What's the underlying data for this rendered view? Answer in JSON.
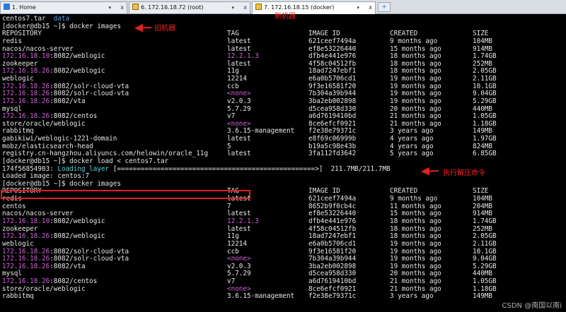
{
  "tabs": [
    {
      "label": "1. Home",
      "icon": "home-icon"
    },
    {
      "label": "6. 172.16.18.72 (root)",
      "icon": "pen-icon"
    },
    {
      "label": "7. 172.16.18.15 (docker)",
      "icon": "pen-icon",
      "active": true
    }
  ],
  "new_tab_label": "+",
  "tab_close": "x",
  "tab_dropdown": "▾",
  "annotations": {
    "old_machine": "旧机器",
    "new_machine": "新机器",
    "run_cmd": "执行解压命令"
  },
  "watermark": "CSDN @南国以南i",
  "lines": [
    {
      "segs": [
        [
          "centos7.tar",
          ""
        ],
        [
          "  ",
          ""
        ],
        [
          "data",
          "blue"
        ]
      ]
    },
    {
      "segs": [
        [
          "[docker@db15 ~]$ docker images",
          ""
        ]
      ]
    },
    {
      "cols": [
        "REPOSITORY",
        "TAG",
        "IMAGE ID",
        "CREATED",
        "SIZE"
      ]
    },
    {
      "cols": [
        "redis",
        "latest",
        "621ceef7494a",
        "9 months ago",
        "104MB"
      ]
    },
    {
      "cols": [
        "nacos/nacos-server",
        "latest",
        "ef8e53226440",
        "15 months ago",
        "914MB"
      ]
    },
    {
      "cols": [
        "172.16.18.10:8082/weblogic",
        "12.2.1.3",
        "dfb4e441e976",
        "18 months ago",
        "1.74GB"
      ],
      "ip": "172.16.18.10",
      "tagc": "pink"
    },
    {
      "cols": [
        "zookeeper",
        "latest",
        "4f58c04512fb",
        "18 months ago",
        "252MB"
      ]
    },
    {
      "cols": [
        "172.16.18.26:8082/weblogic",
        "11g",
        "18ad7247ebf1",
        "18 months ago",
        "2.05GB"
      ],
      "ip": "172.16.18.26"
    },
    {
      "cols": [
        "weblogic",
        "12214",
        "e6a0b5706cd1",
        "19 months ago",
        "2.11GB"
      ]
    },
    {
      "cols": [
        "172.16.18.26:8082/solr-cloud-vta",
        "ccb",
        "9f3e16581f20",
        "19 months ago",
        "10.1GB"
      ],
      "ip": "172.16.18.26"
    },
    {
      "cols": [
        "172.16.18.26:8082/solr-cloud-vta",
        "<none>",
        "7b304a39b944",
        "19 months ago",
        "9.04GB"
      ],
      "ip": "172.16.18.26",
      "tagc": "pink"
    },
    {
      "cols": [
        "172.16.18.26:8082/vta",
        "v2.0.3",
        "3ba2eb002898",
        "19 months ago",
        "5.29GB"
      ],
      "ip": "172.16.18.26"
    },
    {
      "cols": [
        "mysql",
        "5.7.29",
        "d5cea958d330",
        "20 months ago",
        "440MB"
      ]
    },
    {
      "cols": [
        "172.16.18.26:8082/centos",
        "v7",
        "a6d7619410bd",
        "21 months ago",
        "1.05GB"
      ],
      "ip": "172.16.18.26"
    },
    {
      "cols": [
        "store/oracle/weblogic",
        "<none>",
        "8ce6efcf0921",
        "21 months ago",
        "1.18GB"
      ],
      "tagc": "pink"
    },
    {
      "cols": [
        "rabbitmq",
        "3.6.15-management",
        "f2e38e79371c",
        "3 years ago",
        "149MB"
      ]
    },
    {
      "cols": [
        "gabikiwi/weblogic-1221-domain",
        "latest",
        "e8f69c06999b",
        "4 years ago",
        "1.97GB"
      ]
    },
    {
      "cols": [
        "mobz/elasticsearch-head",
        "5",
        "b19a5c98e43b",
        "4 years ago",
        "824MB"
      ]
    },
    {
      "cols": [
        "registry.cn-hangzhou.aliyuncs.com/helowin/oracle_11g",
        "latest",
        "3fa112fd3642",
        "5 years ago",
        "6.85GB"
      ]
    },
    {
      "segs": [
        [
          "[docker@db15 ~]$ docker load < centos7.tar",
          ""
        ]
      ]
    },
    {
      "segs": [
        [
          "174f56854903: ",
          ""
        ],
        [
          "Loading layer",
          "green"
        ],
        [
          " [==================================================>]  211.7MB/211.7MB",
          ""
        ]
      ]
    },
    {
      "segs": [
        [
          "Loaded image: centos:7",
          ""
        ]
      ]
    },
    {
      "segs": [
        [
          "[docker@db15 ~]$ docker images",
          ""
        ]
      ]
    },
    {
      "cols": [
        "REPOSITORY",
        "TAG",
        "IMAGE ID",
        "CREATED",
        "SIZE"
      ]
    },
    {
      "cols": [
        "redis",
        "latest",
        "621ceef7494a",
        "9 months ago",
        "104MB"
      ]
    },
    {
      "cols": [
        "centos",
        "7",
        "8652b9f0cb4c",
        "11 months ago",
        "204MB"
      ]
    },
    {
      "cols": [
        "nacos/nacos-server",
        "latest",
        "ef8e53226440",
        "15 months ago",
        "914MB"
      ]
    },
    {
      "cols": [
        "172.16.18.10:8082/weblogic",
        "12.2.1.3",
        "dfb4e441e976",
        "18 months ago",
        "1.74GB"
      ],
      "ip": "172.16.18.10",
      "tagc": "pink"
    },
    {
      "cols": [
        "zookeeper",
        "latest",
        "4f58c04512fb",
        "18 months ago",
        "252MB"
      ]
    },
    {
      "cols": [
        "172.16.18.26:8082/weblogic",
        "11g",
        "18ad7247ebf1",
        "18 months ago",
        "2.05GB"
      ],
      "ip": "172.16.18.26"
    },
    {
      "cols": [
        "weblogic",
        "12214",
        "e6a0b5706cd1",
        "19 months ago",
        "2.11GB"
      ]
    },
    {
      "cols": [
        "172.16.18.26:8082/solr-cloud-vta",
        "ccb",
        "9f3e16581f20",
        "19 months ago",
        "10.1GB"
      ],
      "ip": "172.16.18.26"
    },
    {
      "cols": [
        "172.16.18.26:8082/solr-cloud-vta",
        "<none>",
        "7b304a39b944",
        "19 months ago",
        "9.04GB"
      ],
      "ip": "172.16.18.26",
      "tagc": "pink"
    },
    {
      "cols": [
        "172.16.18.26:8082/vta",
        "v2.0.3",
        "3ba2eb002898",
        "19 months ago",
        "5.29GB"
      ],
      "ip": "172.16.18.26"
    },
    {
      "cols": [
        "mysql",
        "5.7.29",
        "d5cea958d330",
        "20 months ago",
        "440MB"
      ]
    },
    {
      "cols": [
        "172.16.18.26:8082/centos",
        "v7",
        "a6d7619410bd",
        "21 months ago",
        "1.05GB"
      ],
      "ip": "172.16.18.26"
    },
    {
      "cols": [
        "store/oracle/weblogic",
        "<none>",
        "8ce6efcf0921",
        "21 months ago",
        "1.18GB"
      ],
      "tagc": "pink"
    },
    {
      "cols": [
        "rabbitmq",
        "3.6.15-management",
        "f2e38e79371c",
        "3 years ago",
        "149MB"
      ]
    }
  ]
}
